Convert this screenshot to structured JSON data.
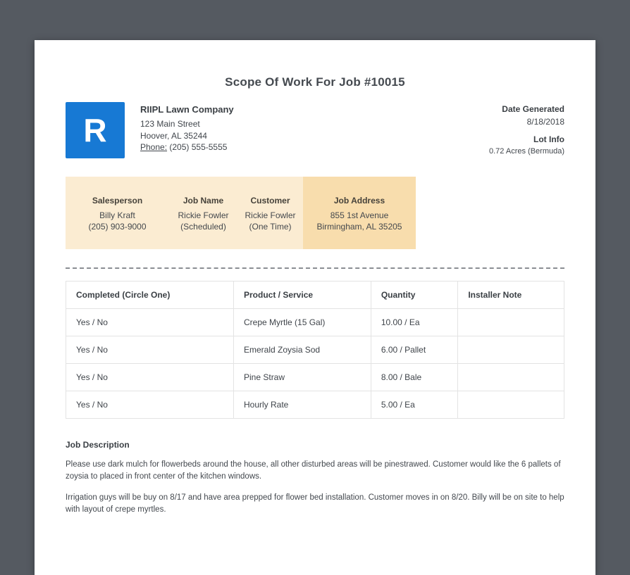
{
  "page": {
    "title": "Scope Of Work For Job #10015"
  },
  "company": {
    "logo_letter": "R",
    "name": "RIIPL Lawn Company",
    "address_line1": "123 Main Street",
    "address_line2": "Hoover, AL 35244",
    "phone_label": "Phone:",
    "phone": "(205) 555-5555"
  },
  "meta": {
    "date_generated_label": "Date Generated",
    "date_generated": "8/18/2018",
    "lot_info_label": "Lot Info",
    "lot_info": "0.72 Acres (Bermuda)"
  },
  "job_info": {
    "columns": [
      {
        "label": "Salesperson",
        "line1": "Billy Kraft",
        "line2": "(205) 903-9000"
      },
      {
        "label": "Job Name",
        "line1": "Rickie Fowler",
        "line2": "(Scheduled)"
      },
      {
        "label": "Customer",
        "line1": "Rickie Fowler",
        "line2": "(One Time)"
      },
      {
        "label": "Job Address",
        "line1": "855 1st Avenue",
        "line2": "Birmingham, AL 35205"
      }
    ]
  },
  "work_table": {
    "headers": [
      "Completed (Circle One)",
      "Product / Service",
      "Quantity",
      "Installer Note"
    ],
    "rows": [
      [
        "Yes / No",
        "Crepe Myrtle (15 Gal)",
        "10.00 / Ea",
        ""
      ],
      [
        "Yes / No",
        "Emerald Zoysia Sod",
        "6.00 / Pallet",
        ""
      ],
      [
        "Yes / No",
        "Pine Straw",
        "8.00 / Bale",
        ""
      ],
      [
        "Yes / No",
        "Hourly Rate",
        "5.00 / Ea",
        ""
      ]
    ]
  },
  "job_description": {
    "heading": "Job Description",
    "paragraphs": [
      "Please use dark mulch for flowerbeds around the house, all other disturbed areas will be pinestrawed. Customer would like the 6 pallets of zoysia to placed in front center of the kitchen windows.",
      "Irrigation guys will be buy on 8/17 and have area prepped for flower bed installation. Customer moves in on 8/20. Billy will be on site to help with layout of crepe myrtles."
    ]
  },
  "colors": {
    "backdrop": "#555a61",
    "logo_blue": "#1779d4",
    "band_background": "#fbecd2",
    "band_highlight": "#f8ddad",
    "text": "#3f444a"
  }
}
